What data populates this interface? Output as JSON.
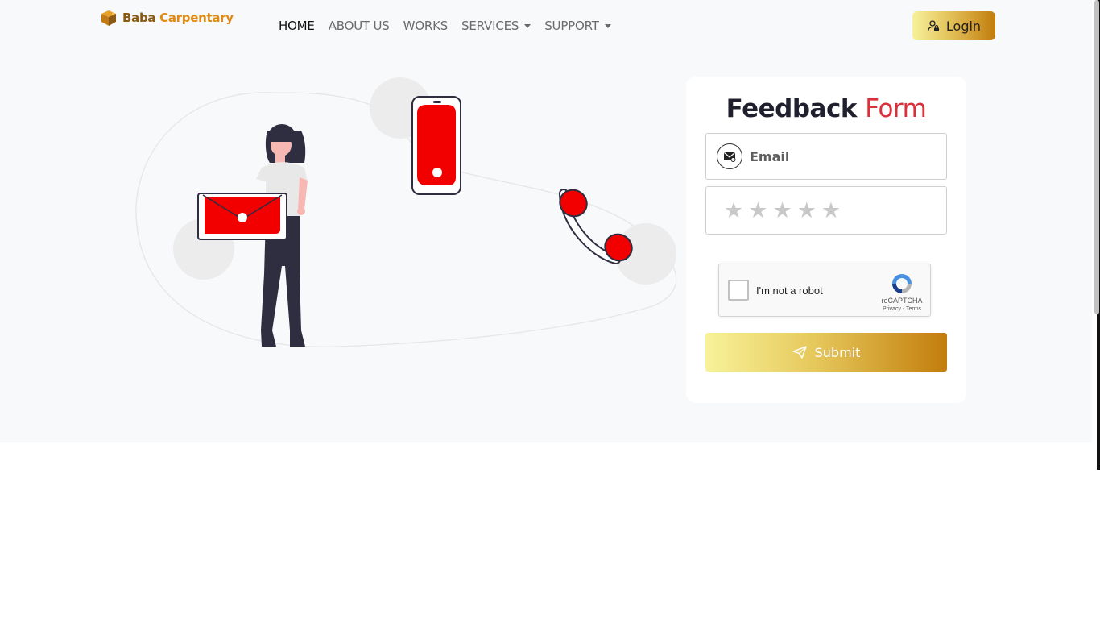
{
  "brand": {
    "name_part1": "Baba",
    "name_part2": "Carpentary",
    "logo_icon": "box-logo-icon"
  },
  "nav": {
    "items": [
      {
        "label": "HOME",
        "active": true,
        "dropdown": false
      },
      {
        "label": "ABOUT US",
        "active": false,
        "dropdown": false
      },
      {
        "label": "WORKS",
        "active": false,
        "dropdown": false
      },
      {
        "label": "SERVICES",
        "active": false,
        "dropdown": true
      },
      {
        "label": "SUPPORT",
        "active": false,
        "dropdown": true
      }
    ],
    "login_label": "Login",
    "login_icon": "user-lock-icon"
  },
  "form": {
    "title_part1": "Feedback",
    "title_part2": "Form",
    "email_placeholder": "Email",
    "email_icon": "envelope-icon",
    "rating": {
      "max": 5,
      "value": 0,
      "star_glyph": "★"
    },
    "recaptcha": {
      "label": "I'm not a robot",
      "brand": "reCAPTCHA",
      "links": "Privacy - Terms"
    },
    "submit_label": "Submit",
    "submit_icon": "send-icon"
  },
  "colors": {
    "accent_red": "#d9303a",
    "illustration_red": "#f20000",
    "gold_start": "#f7f19a",
    "gold_end": "#c27d0c",
    "hero_background": "#f8f9fb"
  }
}
